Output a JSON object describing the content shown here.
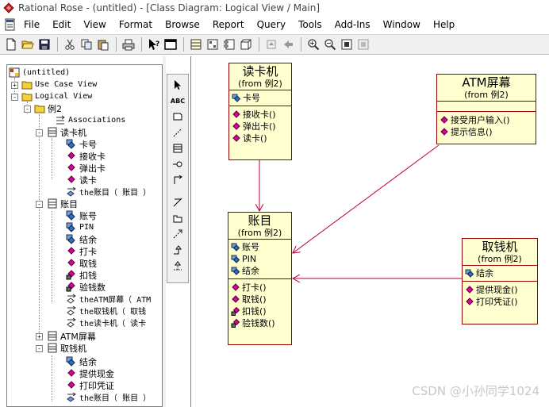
{
  "window": {
    "title": "Rational Rose - (untitled) - [Class Diagram: Logical View / Main]"
  },
  "menu": [
    "File",
    "Edit",
    "View",
    "Format",
    "Browse",
    "Report",
    "Query",
    "Tools",
    "Add-Ins",
    "Window",
    "Help"
  ],
  "toolbar": {
    "icons": [
      "new-file-icon",
      "open-folder-icon",
      "save-icon",
      "cut-icon",
      "copy-icon",
      "paste-icon",
      "print-icon",
      "context-help-icon",
      "view-docs-icon",
      "browse-class-icon",
      "browse-interaction-icon",
      "browse-component-icon",
      "browse-deployment-icon",
      "browse-parent-icon",
      "browse-previous-icon",
      "zoom-in-icon",
      "zoom-out-icon",
      "fit-in-window-icon",
      "undo-fit-icon"
    ]
  },
  "tree": {
    "root": "(untitled)",
    "use_case_view": "Use Case View",
    "logical_view": "Logical View",
    "package": "例2",
    "associations": "Associations",
    "card_reader": {
      "name": "读卡机",
      "attrs": [
        "卡号"
      ],
      "ops": [
        "接收卡",
        "弹出卡",
        "读卡"
      ],
      "roles": [
        "the账目（ 账目 ）"
      ]
    },
    "account": {
      "name": "账目",
      "attrs": [
        "账号",
        "PIN",
        "结余"
      ],
      "ops": [
        "打卡",
        "取钱",
        "扣钱",
        "验钱数"
      ],
      "roles": [
        "theATM屏幕（ ATM",
        "the取钱机（ 取钱",
        "the读卡机（ 读卡"
      ]
    },
    "atm_screen": {
      "name": "ATM屏幕"
    },
    "cash_dispenser": {
      "name": "取钱机",
      "attrs": [
        "结余"
      ],
      "ops": [
        "提供现金",
        "打印凭证"
      ],
      "roles": [
        "the账目（ 账目 ）"
      ]
    }
  },
  "diagram": {
    "card_reader": {
      "name": "读卡机",
      "from": "(from 例2)",
      "attrs": [
        "卡号"
      ],
      "ops": [
        "接收卡()",
        "弹出卡()",
        "读卡()"
      ]
    },
    "atm_screen": {
      "name": "ATM屏幕",
      "from": "(from 例2)",
      "attrs": [],
      "ops": [
        "接受用户输入()",
        "提示信息()"
      ]
    },
    "account": {
      "name": "账目",
      "from": "(from 例2)",
      "attrs": [
        "账号",
        "PIN",
        "结余"
      ],
      "ops": [
        "打卡()",
        "取钱()",
        "扣钱()",
        "验钱数()"
      ]
    },
    "cash_dispenser": {
      "name": "取钱机",
      "from": "(from 例2)",
      "attrs": [
        "结余"
      ],
      "ops": [
        "提供现金()",
        "打印凭证()"
      ]
    }
  },
  "watermark": "CSDN @小孙同学1024"
}
